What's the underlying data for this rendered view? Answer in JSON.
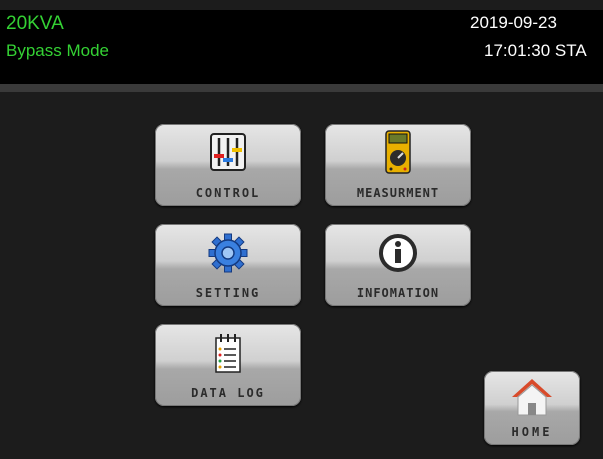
{
  "header": {
    "model": "20KVA",
    "mode": "Bypass Mode",
    "date": "2019-09-23",
    "time_status": "17:01:30 STA",
    "model_color": "#34d134"
  },
  "menu": {
    "control_label": "CONTROL",
    "measurement_label": "MEASURMENT",
    "setting_label": "SETTING",
    "information_label": "INFOMATION",
    "datalog_label": "DATA LOG",
    "home_label": "HOME"
  },
  "icons": {
    "control": "mixer-sliders-icon",
    "measurement": "multimeter-icon",
    "setting": "gear-icon",
    "information": "info-icon",
    "datalog": "notepad-icon",
    "home": "house-icon"
  }
}
